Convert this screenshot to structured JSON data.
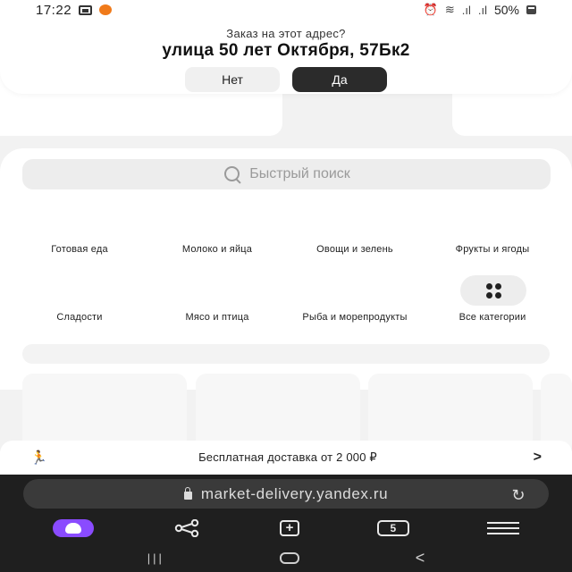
{
  "status_bar": {
    "time": "17:22",
    "battery": "50%",
    "icons": [
      "gallery-icon",
      "app-notification-icon",
      "alarm-icon",
      "wifi-icon",
      "signal-icon",
      "signal-icon",
      "battery-icon"
    ]
  },
  "address_prompt": {
    "question": "Заказ на этот адрес?",
    "address": "улица 50 лет Октября, 57Бк2",
    "no_label": "Нет",
    "yes_label": "Да"
  },
  "search": {
    "placeholder": "Быстрый поиск"
  },
  "categories": [
    "Готовая еда",
    "Молоко и яйца",
    "Овощи и зелень",
    "Фрукты и ягоды",
    "Сладости",
    "Мясо и птица",
    "Рыба и морепродукты",
    "Все категории"
  ],
  "delivery_banner": {
    "text": "Бесплатная доставка от 2 000 ₽",
    "chevron": ">"
  },
  "browser": {
    "url": "market-delivery.yandex.ru",
    "tab_count": "5",
    "new_tab_symbol": "+"
  },
  "colors": {
    "yes_button": "#2b2b2b",
    "alice_button": "#8a4bff",
    "browser_bg": "#1f1f1f"
  }
}
